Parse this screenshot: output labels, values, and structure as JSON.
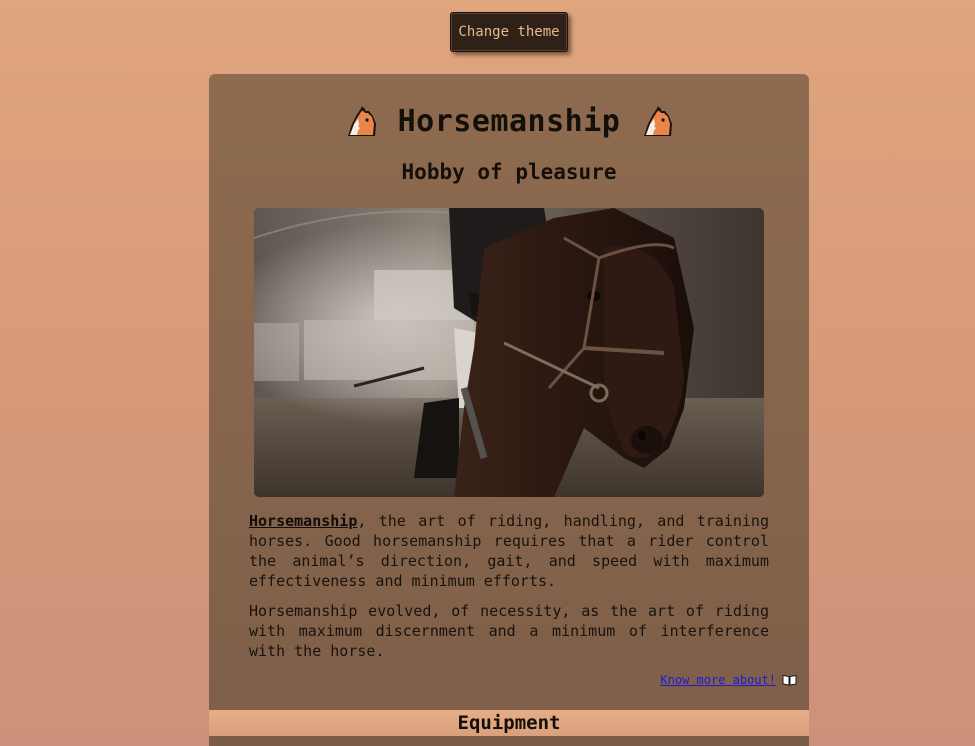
{
  "header": {
    "theme_button_label": "Change theme"
  },
  "card": {
    "title": "Horsemanship",
    "title_icon": "horse-face-icon",
    "subtitle": "Hobby of pleasure",
    "hero_image": "rider-on-dark-brown-horse-in-arena-photo",
    "paragraph1": {
      "term": "Horsemanship",
      "text": ", the art of riding, handling, and training horses. Good horsemanship requires that a rider control the animal’s direction, gait, and speed with maximum effectiveness and minimum efforts."
    },
    "paragraph2": "Horsemanship evolved, of necessity, as the art of riding with maximum discernment and a minimum of interference with the horse.",
    "know_more_label": "Know more about!",
    "know_more_icon": "open-book-icon"
  },
  "sections": {
    "equipment_heading": "Equipment"
  },
  "colors": {
    "page_bg": "#dfa57d",
    "card_bg": "#8e6b4f",
    "button_bg": "#2f2117",
    "button_text": "#e7b98c",
    "link": "#1b1bd6"
  }
}
